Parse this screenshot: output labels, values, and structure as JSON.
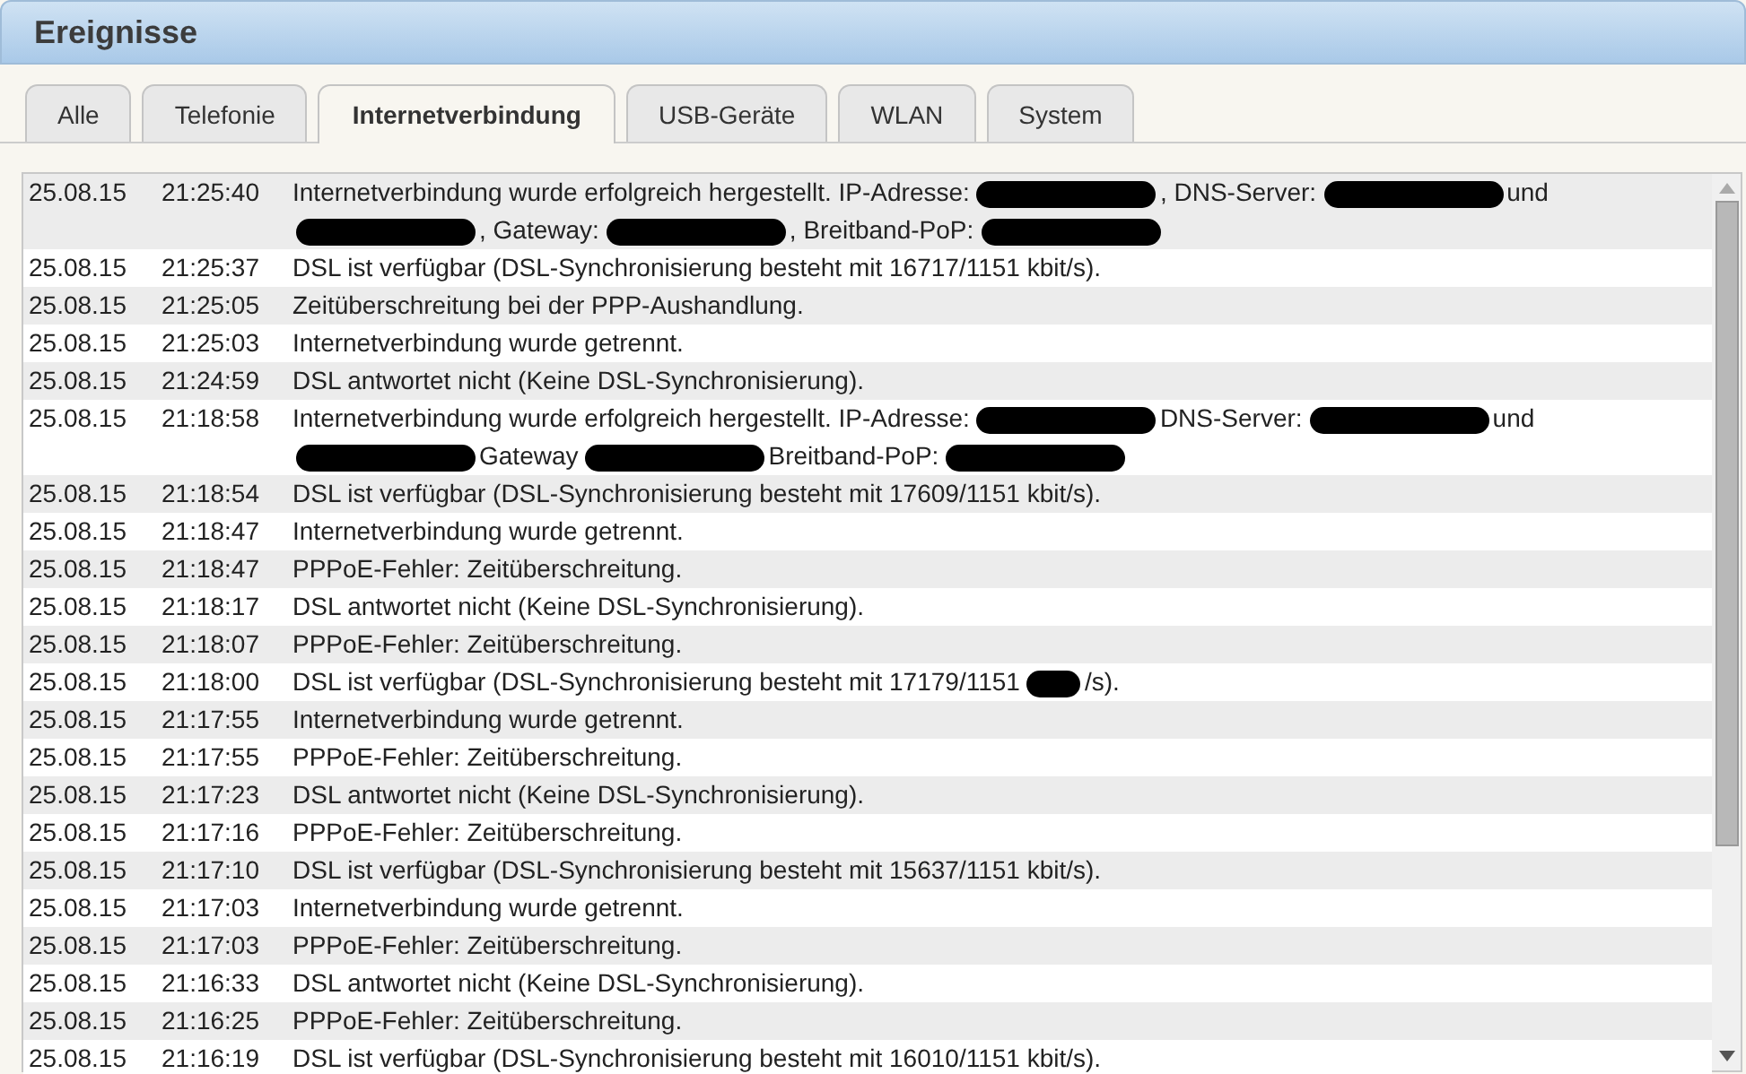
{
  "header": {
    "title": "Ereignisse"
  },
  "tabs": [
    {
      "label": "Alle",
      "selected": false
    },
    {
      "label": "Telefonie",
      "selected": false
    },
    {
      "label": "Internetverbindung",
      "selected": true
    },
    {
      "label": "USB-Geräte",
      "selected": false
    },
    {
      "label": "WLAN",
      "selected": false
    },
    {
      "label": "System",
      "selected": false
    }
  ],
  "events": [
    {
      "date": "25.08.15",
      "time": "21:25:40",
      "segments": [
        {
          "kind": "text",
          "text": "Internetverbindung wurde erfolgreich hergestellt. IP-Adresse:"
        },
        {
          "kind": "redacted"
        },
        {
          "kind": "text",
          "text": ", DNS-Server:"
        },
        {
          "kind": "redacted"
        },
        {
          "kind": "text",
          "text": "und"
        },
        {
          "kind": "redacted"
        },
        {
          "kind": "text",
          "text": ", Gateway:"
        },
        {
          "kind": "redacted"
        },
        {
          "kind": "text",
          "text": ", Breitband-PoP:"
        },
        {
          "kind": "redacted"
        }
      ]
    },
    {
      "date": "25.08.15",
      "time": "21:25:37",
      "segments": [
        {
          "kind": "text",
          "text": "DSL ist verfügbar (DSL-Synchronisierung besteht mit 16717/1151 kbit/s)."
        }
      ]
    },
    {
      "date": "25.08.15",
      "time": "21:25:05",
      "segments": [
        {
          "kind": "text",
          "text": "Zeitüberschreitung bei der PPP-Aushandlung."
        }
      ]
    },
    {
      "date": "25.08.15",
      "time": "21:25:03",
      "segments": [
        {
          "kind": "text",
          "text": "Internetverbindung wurde getrennt."
        }
      ]
    },
    {
      "date": "25.08.15",
      "time": "21:24:59",
      "segments": [
        {
          "kind": "text",
          "text": "DSL antwortet nicht (Keine DSL-Synchronisierung)."
        }
      ]
    },
    {
      "date": "25.08.15",
      "time": "21:18:58",
      "segments": [
        {
          "kind": "text",
          "text": "Internetverbindung wurde erfolgreich hergestellt. IP-Adresse:"
        },
        {
          "kind": "redacted"
        },
        {
          "kind": "text",
          "text": "DNS-Server:"
        },
        {
          "kind": "redacted"
        },
        {
          "kind": "text",
          "text": "und"
        },
        {
          "kind": "redacted"
        },
        {
          "kind": "text",
          "text": "Gateway"
        },
        {
          "kind": "redacted"
        },
        {
          "kind": "text",
          "text": "Breitband-PoP:"
        },
        {
          "kind": "redacted"
        }
      ]
    },
    {
      "date": "25.08.15",
      "time": "21:18:54",
      "segments": [
        {
          "kind": "text",
          "text": "DSL ist verfügbar (DSL-Synchronisierung besteht mit 17609/1151 kbit/s)."
        }
      ]
    },
    {
      "date": "25.08.15",
      "time": "21:18:47",
      "segments": [
        {
          "kind": "text",
          "text": "Internetverbindung wurde getrennt."
        }
      ]
    },
    {
      "date": "25.08.15",
      "time": "21:18:47",
      "segments": [
        {
          "kind": "text",
          "text": "PPPoE-Fehler: Zeitüberschreitung."
        }
      ]
    },
    {
      "date": "25.08.15",
      "time": "21:18:17",
      "segments": [
        {
          "kind": "text",
          "text": "DSL antwortet nicht (Keine DSL-Synchronisierung)."
        }
      ]
    },
    {
      "date": "25.08.15",
      "time": "21:18:07",
      "segments": [
        {
          "kind": "text",
          "text": "PPPoE-Fehler: Zeitüberschreitung."
        }
      ]
    },
    {
      "date": "25.08.15",
      "time": "21:18:00",
      "segments": [
        {
          "kind": "text",
          "text": "DSL ist verfügbar (DSL-Synchronisierung besteht mit 17179/1151"
        },
        {
          "kind": "redacted"
        },
        {
          "kind": "text",
          "text": "/s)."
        }
      ]
    },
    {
      "date": "25.08.15",
      "time": "21:17:55",
      "segments": [
        {
          "kind": "text",
          "text": "Internetverbindung wurde getrennt."
        }
      ]
    },
    {
      "date": "25.08.15",
      "time": "21:17:55",
      "segments": [
        {
          "kind": "text",
          "text": "PPPoE-Fehler: Zeitüberschreitung."
        }
      ]
    },
    {
      "date": "25.08.15",
      "time": "21:17:23",
      "segments": [
        {
          "kind": "text",
          "text": "DSL antwortet nicht (Keine DSL-Synchronisierung)."
        }
      ]
    },
    {
      "date": "25.08.15",
      "time": "21:17:16",
      "segments": [
        {
          "kind": "text",
          "text": "PPPoE-Fehler: Zeitüberschreitung."
        }
      ]
    },
    {
      "date": "25.08.15",
      "time": "21:17:10",
      "segments": [
        {
          "kind": "text",
          "text": "DSL ist verfügbar (DSL-Synchronisierung besteht mit 15637/1151 kbit/s)."
        }
      ]
    },
    {
      "date": "25.08.15",
      "time": "21:17:03",
      "segments": [
        {
          "kind": "text",
          "text": "Internetverbindung wurde getrennt."
        }
      ]
    },
    {
      "date": "25.08.15",
      "time": "21:17:03",
      "segments": [
        {
          "kind": "text",
          "text": "PPPoE-Fehler: Zeitüberschreitung."
        }
      ]
    },
    {
      "date": "25.08.15",
      "time": "21:16:33",
      "segments": [
        {
          "kind": "text",
          "text": "DSL antwortet nicht (Keine DSL-Synchronisierung)."
        }
      ]
    },
    {
      "date": "25.08.15",
      "time": "21:16:25",
      "segments": [
        {
          "kind": "text",
          "text": "PPPoE-Fehler: Zeitüberschreitung."
        }
      ]
    },
    {
      "date": "25.08.15",
      "time": "21:16:19",
      "segments": [
        {
          "kind": "text",
          "text": "DSL ist verfügbar (DSL-Synchronisierung besteht mit 16010/1151 kbit/s)."
        }
      ]
    }
  ]
}
